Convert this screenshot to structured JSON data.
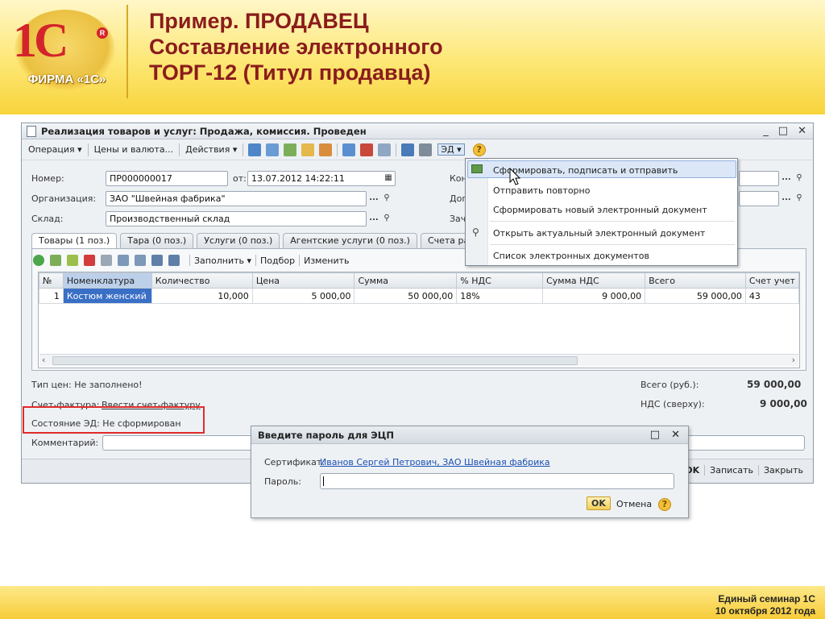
{
  "slide": {
    "title_lines": [
      "Пример. ПРОДАВЕЦ",
      "Составление электронного",
      "ТОРГ-12 (Титул продавца)"
    ],
    "logo_text": "ФИРМА «1С»",
    "logo_mark": "1С",
    "footer_line1": "Единый семинар 1С",
    "footer_line2": "10 октября 2012 года"
  },
  "window": {
    "title": "Реализация товаров и услуг: Продажа, комиссия. Проведен",
    "controls": [
      "_",
      "□",
      "✕"
    ],
    "toolbar": {
      "operation": "Операция ▾",
      "prices": "Цены и валюта...",
      "actions": "Действия ▾",
      "ed": "ЭД ▾",
      "help": "?"
    },
    "fields": {
      "number_label": "Номер:",
      "number_value": "ПР000000017",
      "date_label": "от:",
      "date_value": "13.07.2012 14:22:11",
      "org_label": "Организация:",
      "org_value": "ЗАО \"Швейная фабрика\"",
      "warehouse_label": "Склад:",
      "warehouse_value": "Производственный склад",
      "right_label1": "Кон",
      "right_label2": "Дог",
      "right_label3": "Зач",
      "dots": "...",
      "search": "⚲"
    },
    "tabs": [
      {
        "label": "Товары (1 поз.)",
        "active": true
      },
      {
        "label": "Тара (0 поз.)",
        "active": false
      },
      {
        "label": "Услуги (0 поз.)",
        "active": false
      },
      {
        "label": "Агентские услуги (0 поз.)",
        "active": false
      },
      {
        "label": "Счета ра",
        "active": false
      }
    ],
    "subtoolbar": {
      "fill": "Заполнить ▾",
      "select": "Подбор",
      "change": "Изменить"
    },
    "grid": {
      "headers": [
        "№",
        "Номенклатура",
        "Количество",
        "Цена",
        "Сумма",
        "% НДС",
        "Сумма НДС",
        "Всего",
        "Счет учет"
      ],
      "rows": [
        [
          "1",
          "Костюм женский",
          "10,000",
          "5 000,00",
          "50 000,00",
          "18%",
          "9 000,00",
          "59 000,00",
          "43"
        ]
      ]
    },
    "bottom": {
      "price_type": "Тип цен: Не заполнено!",
      "invoice_label": "Счет-фактура:",
      "invoice_link": "Ввести счет-фактуру",
      "ed_state": "Состояние ЭД:  Не сформирован",
      "comment_label": "Комментарий:",
      "total_label": "Всего (руб.):",
      "total_value": "59 000,00",
      "vat_label": "НДС (сверху):",
      "vat_value": "9 000,00",
      "buttons": [
        "OK",
        "Записать",
        "Закрыть"
      ]
    }
  },
  "ed_menu": {
    "items": [
      "Сформировать, подписать и отправить",
      "Отправить повторно",
      "Сформировать новый электронный документ",
      "Открыть актуальный электронный документ",
      "Список электронных документов"
    ]
  },
  "password_dialog": {
    "title": "Введите пароль для ЭЦП",
    "cert_label": "Сертификат:",
    "cert_value": "Иванов Сергей Петрович, ЗАО Швейная фабрика",
    "password_label": "Пароль:",
    "ok": "OK",
    "cancel": "Отмена",
    "help": "?"
  },
  "colors": {
    "header_gold": "#f8d33b",
    "title_red": "#8a1c1c",
    "highlight_red": "#e02b2b",
    "selection_blue": "#3a6fc6"
  }
}
